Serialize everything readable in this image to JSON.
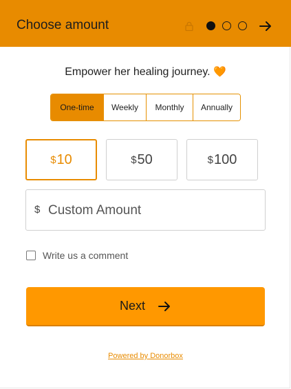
{
  "header": {
    "title": "Choose amount",
    "lock_icon": "lock-icon",
    "steps": [
      true,
      false,
      false
    ],
    "next_icon": "arrow-right-icon",
    "background": "#e88b00"
  },
  "tagline": {
    "text": "Empower her healing journey.",
    "emoji": "🧡"
  },
  "frequency": {
    "options": [
      "One-time",
      "Weekly",
      "Monthly",
      "Annually"
    ],
    "selected": "One-time"
  },
  "amounts": [
    {
      "currency": "$",
      "value": "10",
      "selected": true
    },
    {
      "currency": "$",
      "value": "50",
      "selected": false
    },
    {
      "currency": "$",
      "value": "100",
      "selected": false
    }
  ],
  "custom_amount": {
    "currency": "$",
    "placeholder": "Custom Amount",
    "value": ""
  },
  "comment": {
    "label": "Write us a comment",
    "checked": false
  },
  "next_button": {
    "label": "Next",
    "icon": "arrow-right-icon",
    "color": "#ff9800"
  },
  "footer": {
    "powered_by": "Powered by Donorbox",
    "color": "#e88b00"
  }
}
